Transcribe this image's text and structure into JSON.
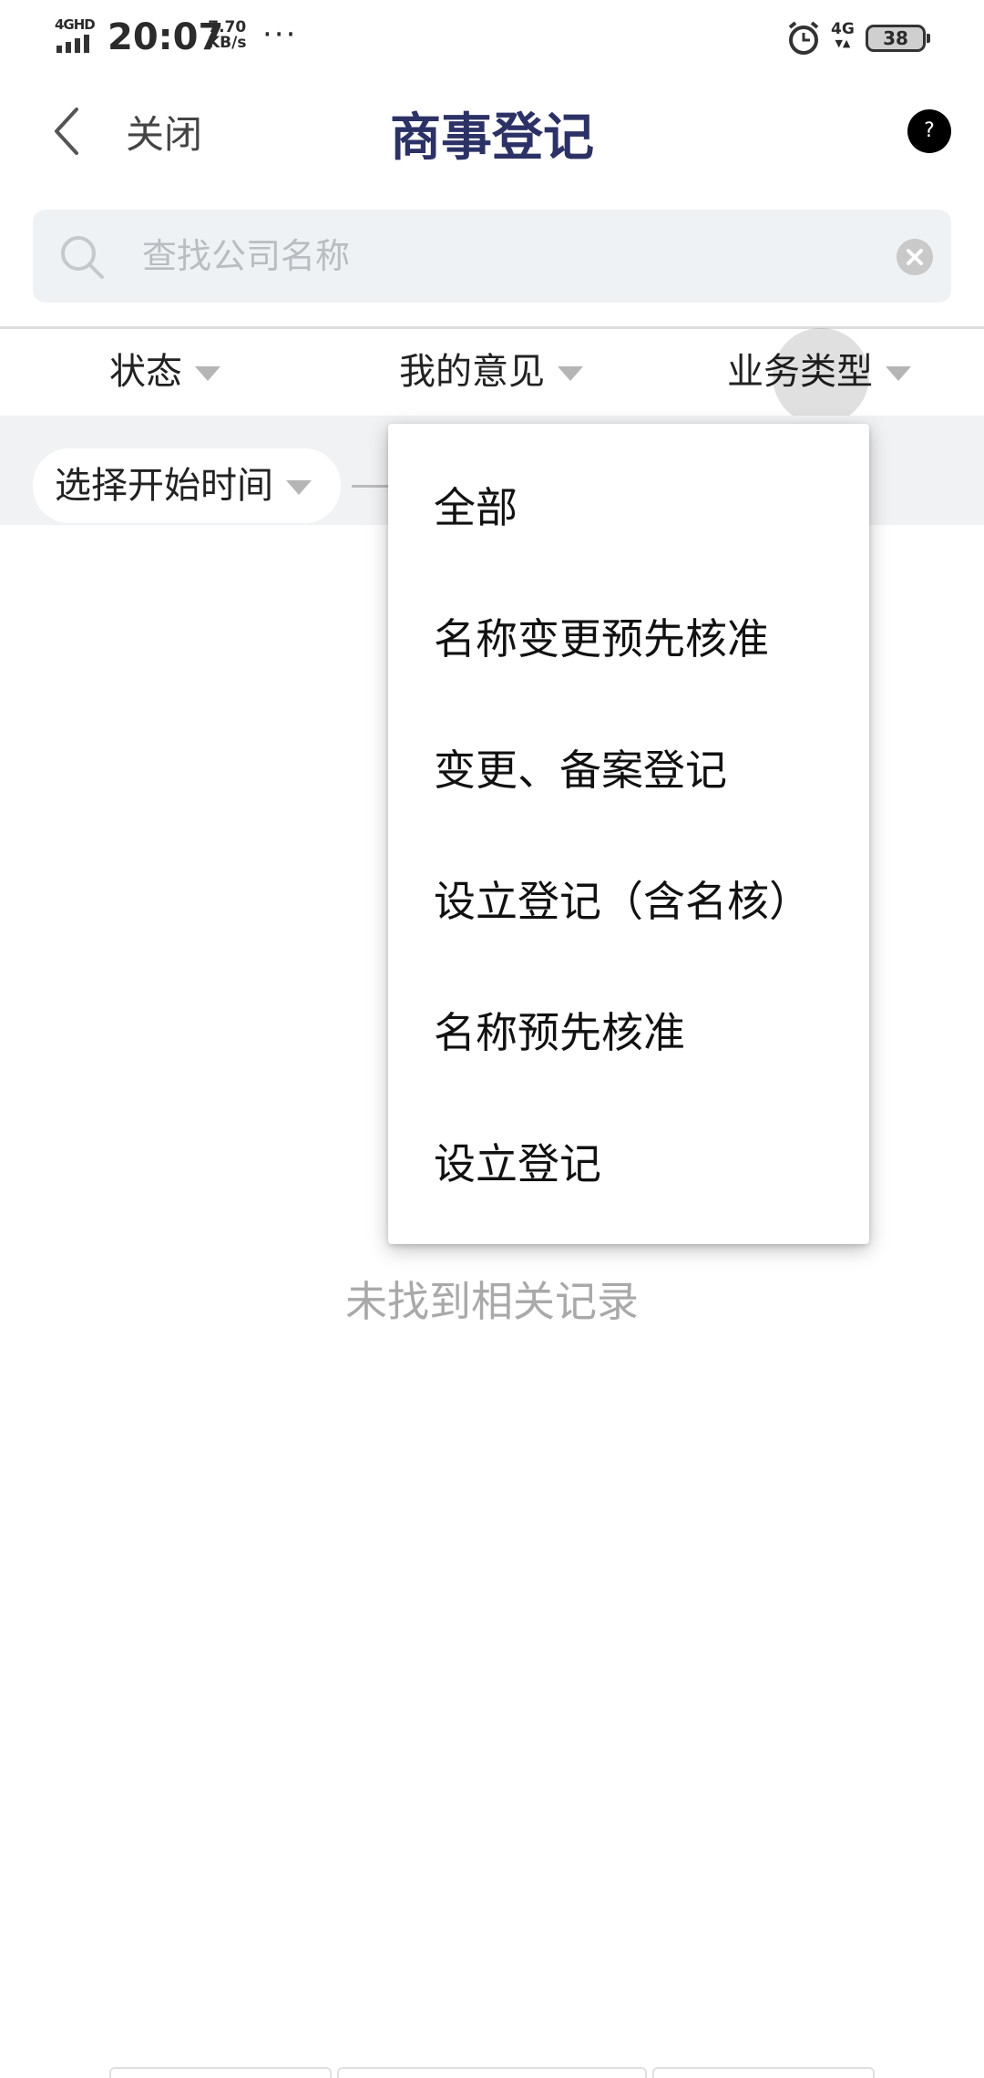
{
  "status_bar": {
    "network": "4GHD",
    "time": "20:07",
    "speed_value": "7.70",
    "speed_unit": "KB/s",
    "more": "···",
    "net_type": "4G",
    "battery": "38"
  },
  "header": {
    "close_label": "关闭",
    "title": "商事登记",
    "help": "?"
  },
  "search": {
    "placeholder": "查找公司名称",
    "value": ""
  },
  "filters": {
    "status": "状态",
    "my_opinion": "我的意见",
    "business_type": "业务类型"
  },
  "date_filter": {
    "start_label": "选择开始时间"
  },
  "empty_message": "未找到相关记录",
  "dropdown": {
    "items": [
      "全部",
      "名称变更预先核准",
      "变更、备案登记",
      "设立登记（含名核）",
      "名称预先核准",
      "设立登记"
    ]
  },
  "colors": {
    "title": "#2c3166",
    "search_bg": "#eff2f4",
    "filter_bg": "#f1f2f4",
    "empty_text": "#a9a9a9"
  }
}
